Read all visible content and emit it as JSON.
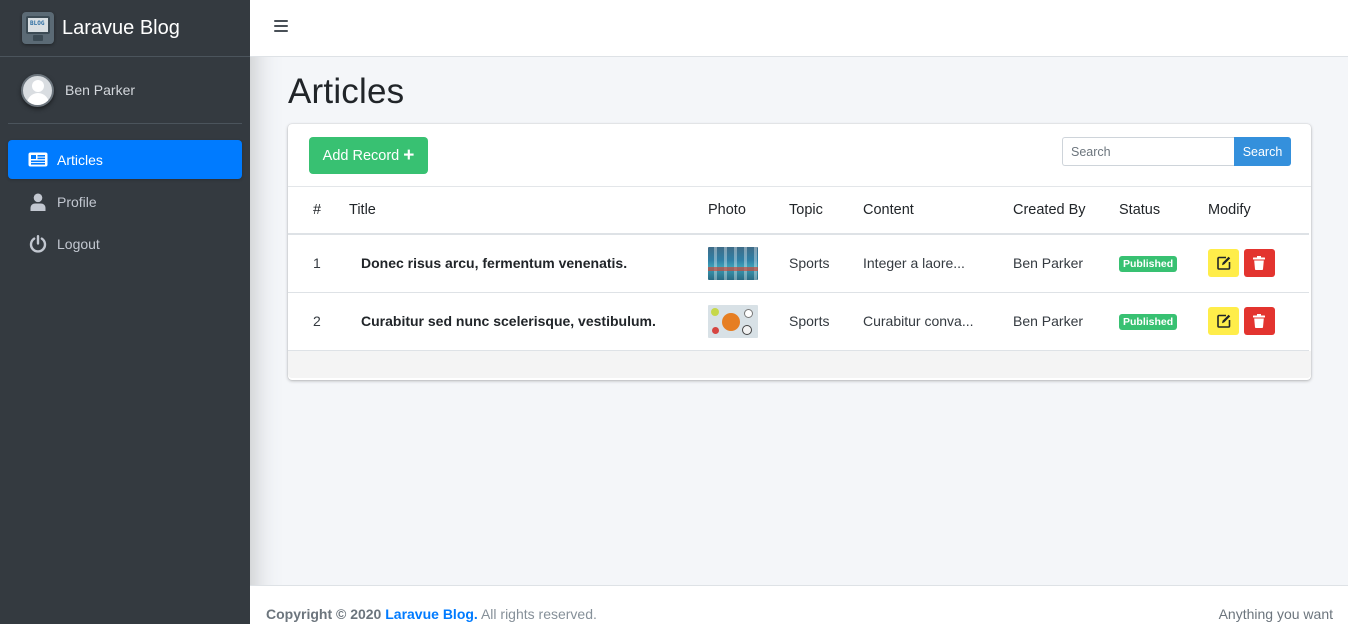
{
  "brand": {
    "name": "Laravue Blog",
    "logo_text": "BLOG"
  },
  "user": {
    "name": "Ben Parker"
  },
  "sidebar": {
    "items": [
      {
        "label": "Articles",
        "icon": "newspaper-icon",
        "active": true
      },
      {
        "label": "Profile",
        "icon": "user-icon",
        "active": false
      },
      {
        "label": "Logout",
        "icon": "power-icon",
        "active": false
      }
    ]
  },
  "navbar": {
    "menu_icon": "hamburger-icon"
  },
  "page": {
    "title": "Articles"
  },
  "toolbar": {
    "add_label": "Add Record",
    "add_icon": "+",
    "search_placeholder": "Search",
    "search_button": "Search"
  },
  "table": {
    "columns": [
      "#",
      "Title",
      "Photo",
      "Topic",
      "Content",
      "Created By",
      "Status",
      "Modify"
    ],
    "rows": [
      {
        "num": "1",
        "title": "Donec risus arcu, fermentum venenatis.",
        "photo": "swimming-pool-photo",
        "topic": "Sports",
        "content": "Integer a laore...",
        "created_by": "Ben Parker",
        "status": "Published"
      },
      {
        "num": "2",
        "title": "Curabitur sed nunc scelerisque, vestibulum.",
        "photo": "sports-balls-photo",
        "topic": "Sports",
        "content": "Curabitur conva...",
        "created_by": "Ben Parker",
        "status": "Published"
      }
    ]
  },
  "footer": {
    "copyright_prefix": "Copyright © 2020",
    "link_text": "Laravue Blog.",
    "suffix": "All rights reserved.",
    "right_text": "Anything you want"
  },
  "colors": {
    "sidebar_bg": "#343a40",
    "active_blue": "#007bff",
    "add_green": "#38c172",
    "search_blue": "#3490dc",
    "edit_yellow": "#ffed4a",
    "delete_red": "#e3342f",
    "badge_green": "#38c172"
  }
}
